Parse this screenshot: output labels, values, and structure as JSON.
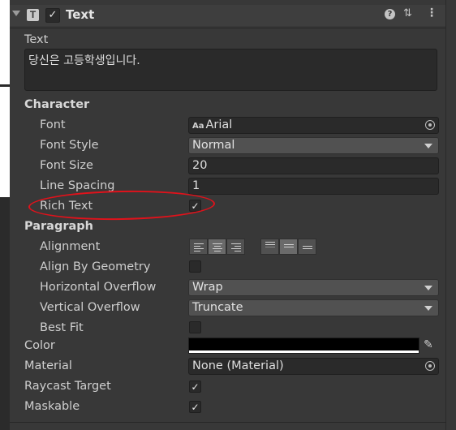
{
  "component": {
    "title": "Text",
    "enabled_check": "✓"
  },
  "text": {
    "label": "Text",
    "value": "당신은 고등학생입니다."
  },
  "character": {
    "section_label": "Character",
    "font": {
      "label": "Font",
      "icon": "Aa",
      "value": "Arial"
    },
    "font_style": {
      "label": "Font Style",
      "value": "Normal"
    },
    "font_size": {
      "label": "Font Size",
      "value": "20"
    },
    "line_spacing": {
      "label": "Line Spacing",
      "value": "1"
    },
    "rich_text": {
      "label": "Rich Text",
      "checked": "✓"
    }
  },
  "paragraph": {
    "section_label": "Paragraph",
    "alignment": {
      "label": "Alignment",
      "horizontal_selected": "center",
      "vertical_selected": "middle"
    },
    "align_by_geometry": {
      "label": "Align By Geometry",
      "checked": ""
    },
    "horizontal_overflow": {
      "label": "Horizontal Overflow",
      "value": "Wrap"
    },
    "vertical_overflow": {
      "label": "Vertical Overflow",
      "value": "Truncate"
    },
    "best_fit": {
      "label": "Best Fit",
      "checked": ""
    }
  },
  "color": {
    "label": "Color",
    "value": "#000000",
    "alpha_bar": "#ffffff"
  },
  "material": {
    "label": "Material",
    "value": "None (Material)"
  },
  "raycast_target": {
    "label": "Raycast Target",
    "checked": "✓"
  },
  "maskable": {
    "label": "Maskable",
    "checked": "✓"
  },
  "annotation": {
    "color": "#e0121b",
    "target": "Rich Text"
  }
}
